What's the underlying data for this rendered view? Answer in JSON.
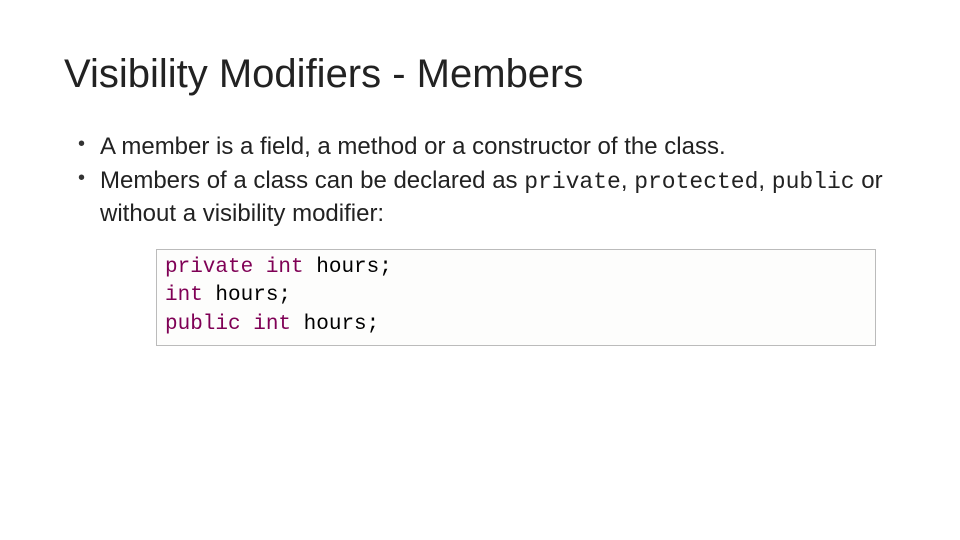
{
  "title": "Visibility Modifiers - Members",
  "bullets": {
    "b1": "A member is a field, a method or a constructor of the class.",
    "b2_pre": "Members of a class can be declared as ",
    "b2_kw1": "private",
    "b2_mid1": ", ",
    "b2_kw2": "protected",
    "b2_mid2": ", ",
    "b2_kw3": "public",
    "b2_post": " or without a visibility modifier:"
  },
  "code": {
    "l1_kw1": "private ",
    "l1_kw2": "int ",
    "l1_id": "hours;",
    "l2_kw": "int ",
    "l2_id": "hours;",
    "l3_kw1": "public ",
    "l3_kw2": "int ",
    "l3_id": "hours;"
  }
}
